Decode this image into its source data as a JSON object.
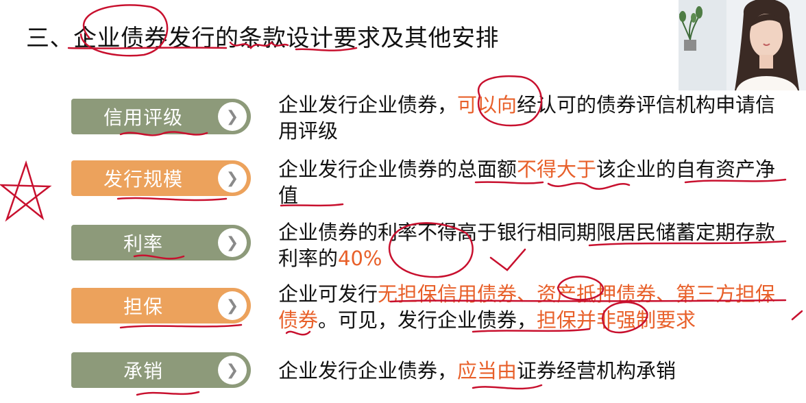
{
  "title": "三、企业债券发行的条款设计要求及其他安排",
  "colors": {
    "green": "#8d9a7a",
    "orange": "#eca25c",
    "highlight": "#e8602a",
    "ink": "#c8102e"
  },
  "rows": [
    {
      "label": "信用评级",
      "style": "green",
      "text": [
        {
          "t": "企业发行企业债券，"
        },
        {
          "t": "可以向",
          "hl": true
        },
        {
          "t": "经认可的债券评信机构申请信用评级"
        }
      ]
    },
    {
      "label": "发行规模",
      "style": "orange",
      "text": [
        {
          "t": "企业发行企业债券的总面额"
        },
        {
          "t": "不得大于",
          "hl": true
        },
        {
          "t": "该企业的自有资产净值"
        }
      ]
    },
    {
      "label": "利率",
      "style": "green",
      "text": [
        {
          "t": "企业债券的利率不得高于银行相同期限居民储蓄定期存款利率的"
        },
        {
          "t": "40%",
          "hl": true
        }
      ]
    },
    {
      "label": "担保",
      "style": "orange",
      "text": [
        {
          "t": "企业可发行"
        },
        {
          "t": "无担保信用债券、资产抵押债券、第三方担保债券",
          "hl": true
        },
        {
          "t": "。可见，发行企业债券，"
        },
        {
          "t": "担保并非强制要求",
          "hl": true
        }
      ]
    },
    {
      "label": "承销",
      "style": "green",
      "text": [
        {
          "t": "企业发行企业债券，"
        },
        {
          "t": "应当由",
          "hl": true
        },
        {
          "t": "证券经营机构承销"
        }
      ]
    }
  ],
  "chevron_glyph": "❯"
}
